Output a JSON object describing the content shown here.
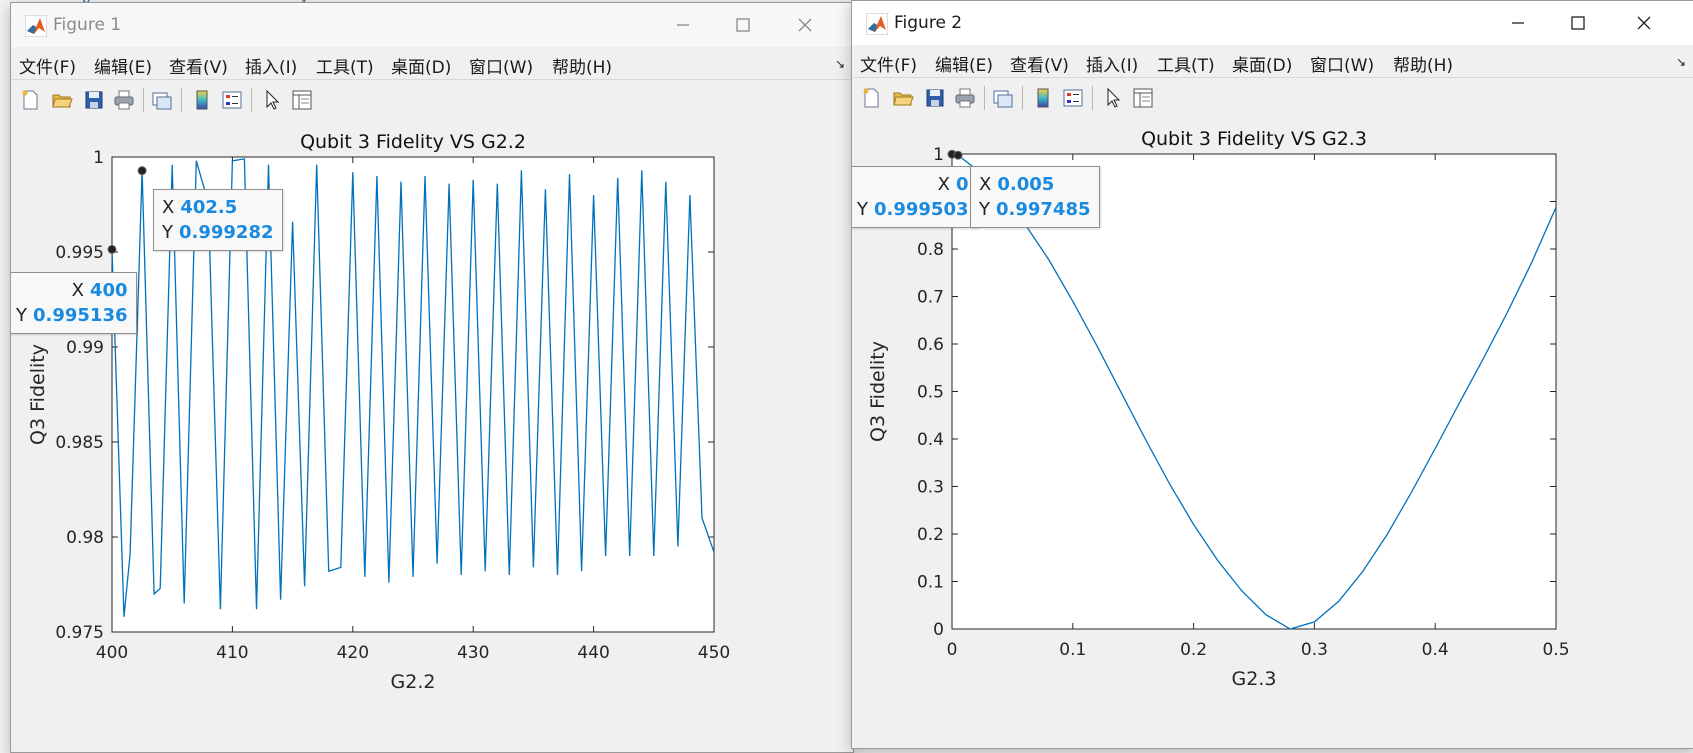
{
  "background": {
    "fragments": [
      "p",
      "y"
    ]
  },
  "windows": [
    {
      "title": "Figure 1",
      "menu": [
        "文件(F)",
        "编辑(E)",
        "查看(V)",
        "插入(I)",
        "工具(T)",
        "桌面(D)",
        "窗口(W)",
        "帮助(H)"
      ],
      "corner": "↘",
      "toolbar_icons": [
        "new-figure-icon",
        "open-file-icon",
        "save-icon",
        "print-icon",
        "link-plot-icon",
        "colorbar-icon",
        "legend-icon",
        "edit-plot-cursor-icon",
        "property-inspector-icon"
      ],
      "chart_data": {
        "type": "line",
        "title": "Qubit 3 Fidelity VS G2.2",
        "xlabel": "G2.2",
        "ylabel": "Q3 Fidelity",
        "xlim": [
          400,
          450
        ],
        "ylim": [
          0.975,
          1
        ],
        "xticks": [
          "400",
          "410",
          "420",
          "430",
          "440",
          "450"
        ],
        "yticks": [
          "0.975",
          "0.98",
          "0.985",
          "0.99",
          "0.995",
          "1"
        ],
        "grid": false,
        "series_color": "#0072bd",
        "series": [
          {
            "x": [
              400,
              401,
              401.5,
              402.5,
              403.5,
              404,
              405,
              406,
              407,
              408,
              409,
              410,
              411,
              412,
              413,
              414,
              415,
              416,
              417,
              418,
              419,
              420,
              421,
              422,
              423,
              424,
              425,
              426,
              427,
              428,
              429,
              430,
              431,
              432,
              433,
              434,
              435,
              436,
              437,
              438,
              439,
              440,
              441,
              442,
              443,
              444,
              445,
              446,
              447,
              448,
              449,
              450
            ],
            "values": [
              0.995136,
              0.9758,
              0.9791,
              0.999282,
              0.977,
              0.9773,
              0.9996,
              0.9765,
              0.9998,
              0.9976,
              0.9762,
              0.9998,
              0.9999,
              0.9762,
              0.9996,
              0.9767,
              0.9966,
              0.9774,
              0.9996,
              0.9782,
              0.9784,
              0.9992,
              0.9779,
              0.999,
              0.9776,
              0.9987,
              0.9779,
              0.999,
              0.9786,
              0.9986,
              0.978,
              0.9988,
              0.9782,
              0.9986,
              0.978,
              0.9993,
              0.9784,
              0.9983,
              0.978,
              0.9991,
              0.9782,
              0.998,
              0.979,
              0.9989,
              0.979,
              0.9993,
              0.979,
              0.9987,
              0.9795,
              0.998,
              0.981,
              0.9792
            ]
          }
        ],
        "datatips": [
          {
            "x_label": "X",
            "x_value": "400",
            "y_label": "Y",
            "y_value": "0.995136",
            "x": 400,
            "y": 0.995136
          },
          {
            "x_label": "X",
            "x_value": "402.5",
            "y_label": "Y",
            "y_value": "0.999282",
            "x": 402.5,
            "y": 0.999282
          }
        ]
      }
    },
    {
      "title": "Figure 2",
      "menu": [
        "文件(F)",
        "编辑(E)",
        "查看(V)",
        "插入(I)",
        "工具(T)",
        "桌面(D)",
        "窗口(W)",
        "帮助(H)"
      ],
      "corner": "↘",
      "toolbar_icons": [
        "new-figure-icon",
        "open-file-icon",
        "save-icon",
        "print-icon",
        "link-plot-icon",
        "colorbar-icon",
        "legend-icon",
        "edit-plot-cursor-icon",
        "property-inspector-icon"
      ],
      "chart_data": {
        "type": "line",
        "title": "Qubit 3 Fidelity VS G2.3",
        "xlabel": "G2.3",
        "ylabel": "Q3 Fidelity",
        "xlim": [
          0,
          0.5
        ],
        "ylim": [
          0,
          1
        ],
        "xticks": [
          "0",
          "0.1",
          "0.2",
          "0.3",
          "0.4",
          "0.5"
        ],
        "yticks": [
          "0",
          "0.1",
          "0.2",
          "0.3",
          "0.4",
          "0.5",
          "0.6",
          "0.7",
          "0.8",
          "0.9",
          "1"
        ],
        "grid": false,
        "series_color": "#0072bd",
        "series": [
          {
            "x": [
              0,
              0.005,
              0.02,
              0.04,
              0.06,
              0.08,
              0.1,
              0.12,
              0.14,
              0.16,
              0.18,
              0.2,
              0.22,
              0.24,
              0.26,
              0.28,
              0.3,
              0.32,
              0.34,
              0.36,
              0.38,
              0.4,
              0.42,
              0.44,
              0.46,
              0.48,
              0.5
            ],
            "values": [
              0.999503,
              0.997485,
              0.968,
              0.918,
              0.854,
              0.778,
              0.69,
              0.596,
              0.498,
              0.4,
              0.306,
              0.22,
              0.144,
              0.08,
              0.03,
              0.0,
              0.015,
              0.058,
              0.121,
              0.198,
              0.286,
              0.38,
              0.476,
              0.57,
              0.668,
              0.772,
              0.888
            ]
          }
        ],
        "datatips": [
          {
            "x_label": "X",
            "x_value": "0",
            "y_label": "Y",
            "y_value": "0.999503",
            "x": 0,
            "y": 0.999503
          },
          {
            "x_label": "X",
            "x_value": "0.005",
            "y_label": "Y",
            "y_value": "0.997485",
            "x": 0.005,
            "y": 0.997485
          }
        ]
      }
    }
  ]
}
